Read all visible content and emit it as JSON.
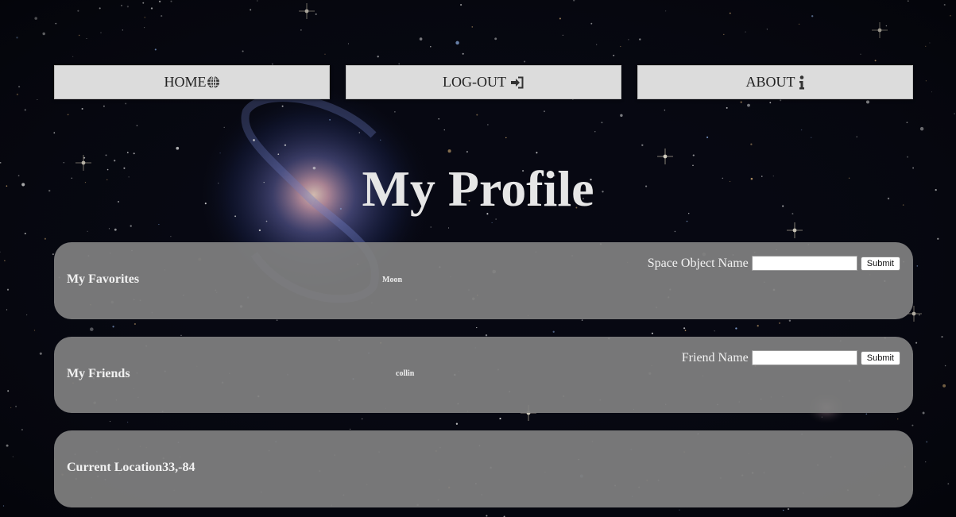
{
  "nav": {
    "home_label": "HOME",
    "logout_label": "LOG-OUT",
    "about_label": "ABOUT",
    "home_icon": "globe-icon",
    "logout_icon": "sign-in-icon",
    "about_icon": "info-icon"
  },
  "page": {
    "title": "My Profile"
  },
  "favorites": {
    "heading": "My Favorites",
    "items": [
      "Moon"
    ],
    "form_label": "Space Object Name",
    "input_value": "",
    "submit_label": "Submit"
  },
  "friends": {
    "heading": "My Friends",
    "items": [
      "collin"
    ],
    "form_label": "Friend Name",
    "input_value": "",
    "submit_label": "Submit"
  },
  "location": {
    "heading": "Current Location",
    "value": "33,-84"
  },
  "colors": {
    "nav_bg": "#dcdcdc",
    "panel_bg": "#808080",
    "title": "#e6e6e6"
  }
}
